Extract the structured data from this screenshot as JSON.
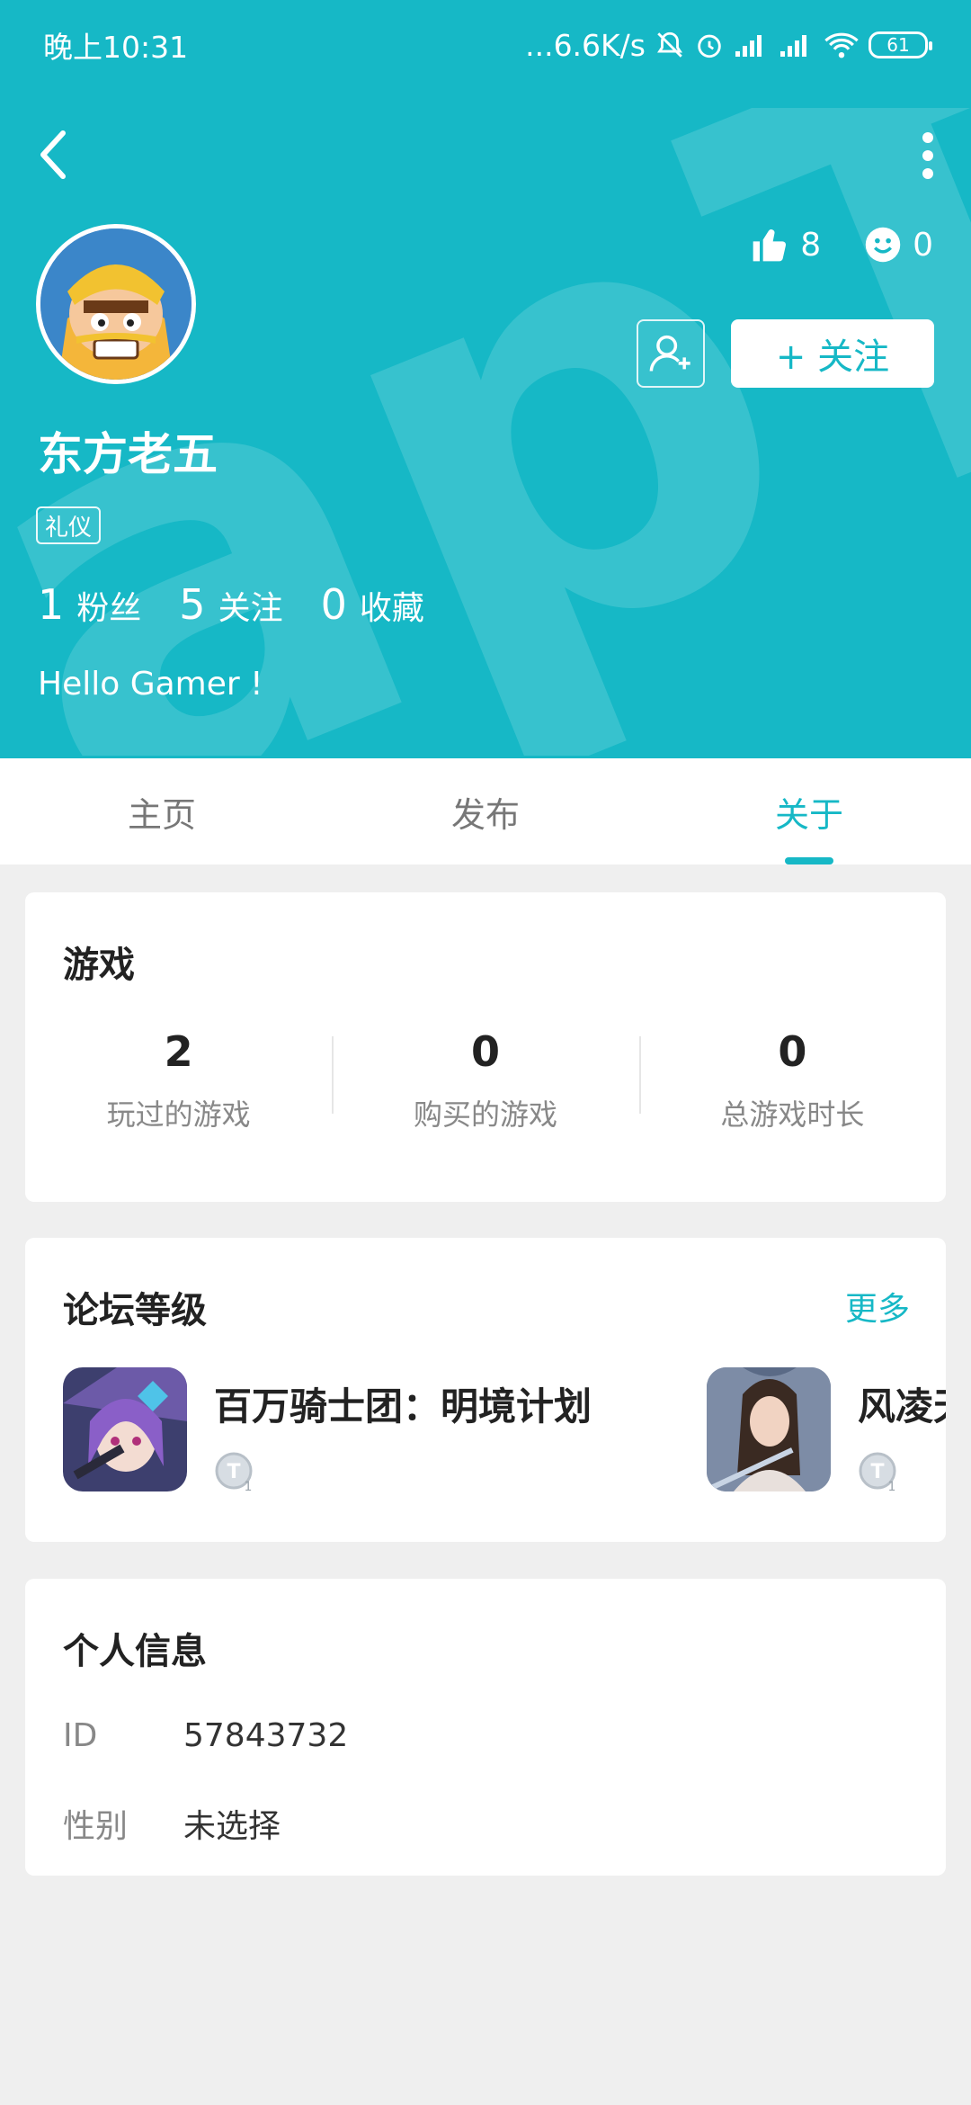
{
  "status_bar": {
    "time": "晚上10:31",
    "network_speed": "...6.6K/s",
    "battery": "61"
  },
  "profile": {
    "username": "东方老五",
    "tag": "礼仪",
    "likes": "8",
    "smiles": "0",
    "follow_label": "+ 关注",
    "bio": "Hello Gamer !",
    "counts": [
      {
        "value": "1",
        "label": "粉丝"
      },
      {
        "value": "5",
        "label": "关注"
      },
      {
        "value": "0",
        "label": "收藏"
      }
    ]
  },
  "tabs": [
    {
      "label": "主页",
      "active": false
    },
    {
      "label": "发布",
      "active": false
    },
    {
      "label": "关于",
      "active": true
    }
  ],
  "games": {
    "title": "游戏",
    "stats": [
      {
        "value": "2",
        "label": "玩过的游戏"
      },
      {
        "value": "0",
        "label": "购买的游戏"
      },
      {
        "value": "0",
        "label": "总游戏时长"
      }
    ]
  },
  "forum": {
    "title": "论坛等级",
    "more_label": "更多",
    "items": [
      {
        "name": "百万骑士团：明境计划",
        "level_icon": "level-1-icon"
      },
      {
        "name": "风凌天",
        "level_icon": "level-1-icon"
      }
    ]
  },
  "personal": {
    "title": "个人信息",
    "rows": [
      {
        "key": "ID",
        "value": "57843732"
      },
      {
        "key": "性别",
        "value": "未选择"
      }
    ]
  },
  "colors": {
    "accent": "#16b8c6",
    "background": "#efefef"
  }
}
